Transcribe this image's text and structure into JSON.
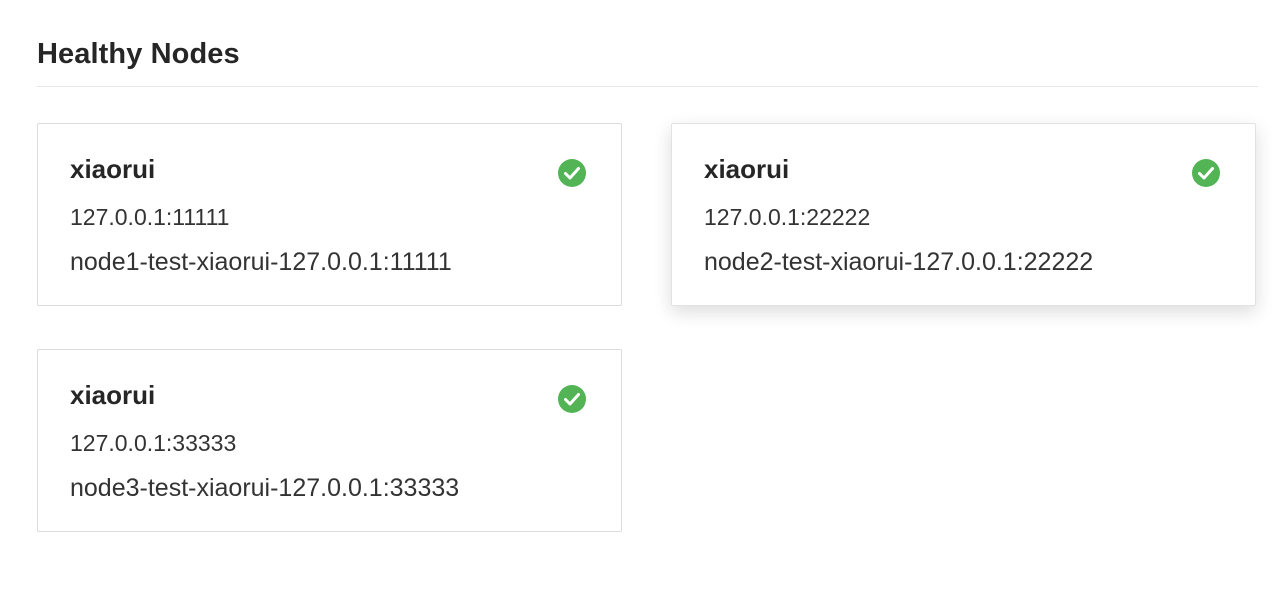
{
  "section": {
    "title": "Healthy Nodes"
  },
  "colors": {
    "healthy": "#52b455",
    "card_border": "#dcdcdc",
    "divider": "#e6e6e6"
  },
  "nodes": [
    {
      "name": "xiaorui",
      "address": "127.0.0.1:11111",
      "id": "node1-test-xiaorui-127.0.0.1:11111",
      "status_icon": "check-circle-icon",
      "hovered": false
    },
    {
      "name": "xiaorui",
      "address": "127.0.0.1:22222",
      "id": "node2-test-xiaorui-127.0.0.1:22222",
      "status_icon": "check-circle-icon",
      "hovered": true
    },
    {
      "name": "xiaorui",
      "address": "127.0.0.1:33333",
      "id": "node3-test-xiaorui-127.0.0.1:33333",
      "status_icon": "check-circle-icon",
      "hovered": false
    }
  ]
}
